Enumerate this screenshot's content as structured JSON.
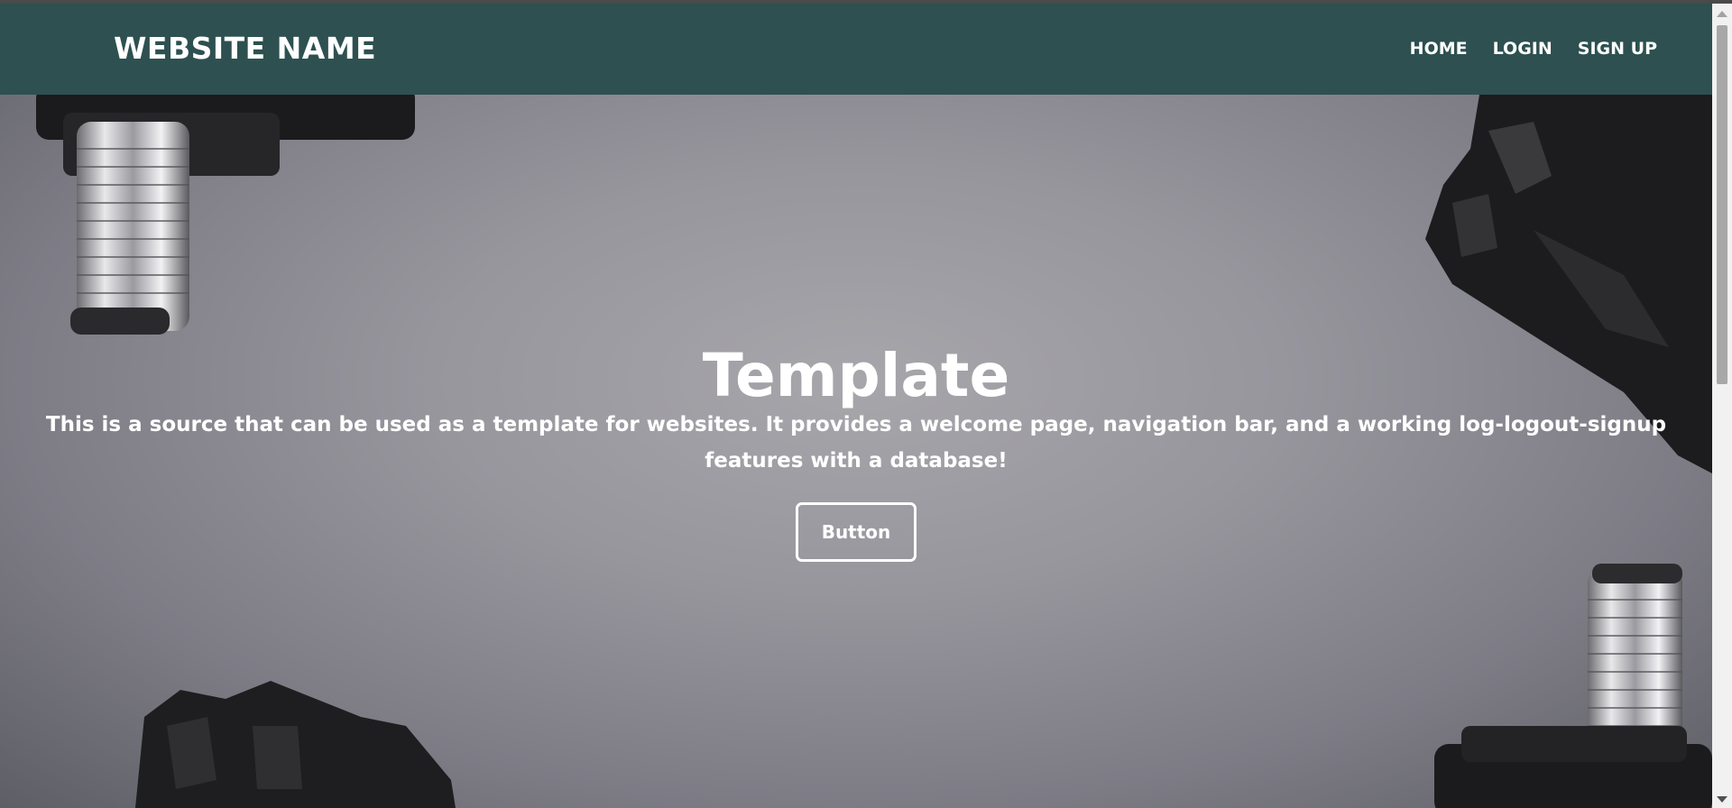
{
  "header": {
    "brand": "WEBSITE NAME",
    "nav": [
      {
        "label": "HOME"
      },
      {
        "label": "LOGIN"
      },
      {
        "label": "SIGN UP"
      }
    ]
  },
  "hero": {
    "title": "Template",
    "description": "This is a source that can be used as a template for websites. It provides a welcome page, navigation bar, and a working log-logout-signup features with a database!",
    "button_label": "Button"
  },
  "colors": {
    "navbar": "#2e5050",
    "text": "#ffffff"
  }
}
